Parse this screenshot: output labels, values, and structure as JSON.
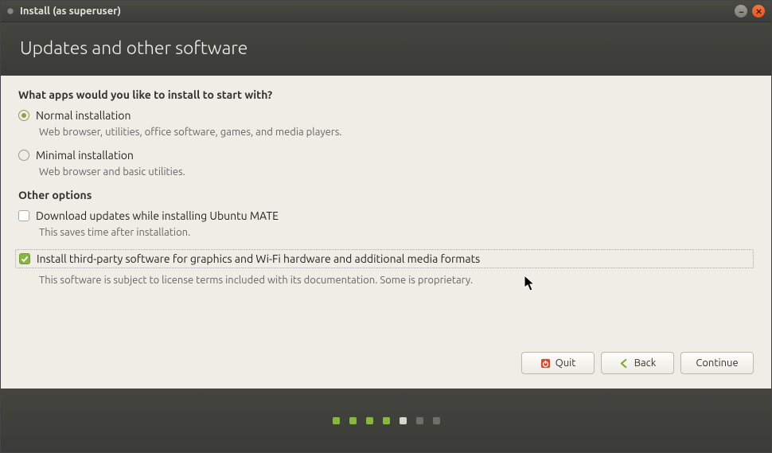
{
  "window": {
    "title": "Install (as superuser)"
  },
  "header": {
    "title": "Updates and other software"
  },
  "section": {
    "question": "What apps would you like to install to start with?",
    "options": [
      {
        "label": "Normal installation",
        "desc": "Web browser, utilities, office software, games, and media players.",
        "checked": true
      },
      {
        "label": "Minimal installation",
        "desc": "Web browser and basic utilities.",
        "checked": false
      }
    ],
    "otherHeading": "Other options",
    "checkboxes": [
      {
        "label": "Download updates while installing Ubuntu MATE",
        "desc": "This saves time after installation.",
        "checked": false
      },
      {
        "label": "Install third-party software for graphics and Wi-Fi hardware and additional media formats",
        "desc": "This software is subject to license terms included with its documentation. Some is proprietary.",
        "checked": true,
        "highlighted": true
      }
    ]
  },
  "buttons": {
    "quit": "Quit",
    "back": "Back",
    "continue": "Continue"
  },
  "progress": {
    "total": 7,
    "completed": 4,
    "current": 5
  }
}
